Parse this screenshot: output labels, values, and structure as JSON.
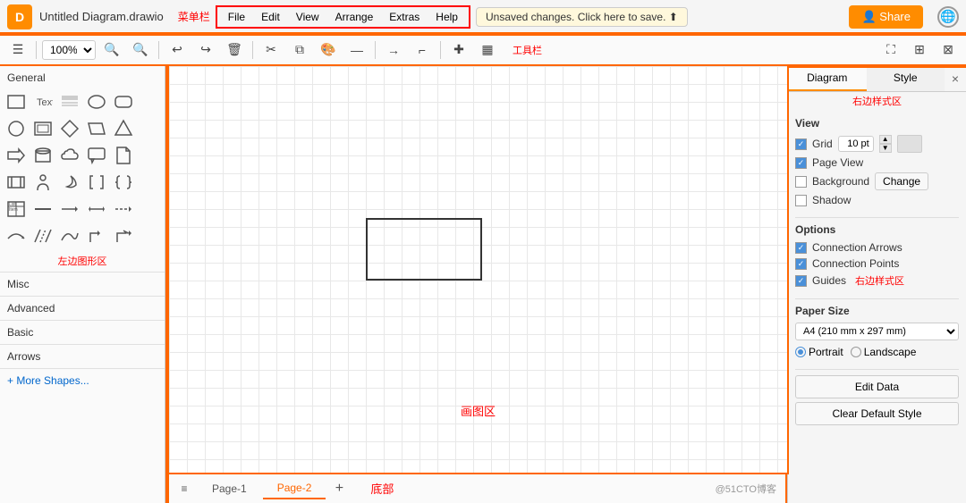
{
  "app": {
    "title": "Untitled Diagram.drawio",
    "title_label": "菜单栏",
    "logo_text": "D"
  },
  "menu": {
    "items": [
      "File",
      "Edit",
      "View",
      "Arrange",
      "Extras",
      "Help"
    ],
    "unsaved": "Unsaved changes. Click here to save. ⬆"
  },
  "share": {
    "label": "Share"
  },
  "toolbar": {
    "label": "工具栏",
    "zoom": "100%"
  },
  "left_panel": {
    "label": "左边图形区",
    "sections": [
      {
        "title": "General"
      },
      {
        "title": "Misc"
      },
      {
        "title": "Advanced"
      },
      {
        "title": "Basic"
      },
      {
        "title": "Arrows"
      }
    ],
    "more_shapes": "+ More Shapes..."
  },
  "canvas": {
    "label": "画图区"
  },
  "bottom": {
    "label": "底部",
    "menu_icon": "≡",
    "tabs": [
      {
        "label": "Page-1",
        "active": false
      },
      {
        "label": "Page-2",
        "active": true
      }
    ],
    "add_icon": "+",
    "watermark": "@51CTO博客"
  },
  "right_panel": {
    "label": "右边样式区",
    "tabs": [
      "Diagram",
      "Style"
    ],
    "close_icon": "×",
    "view_section": {
      "title": "View",
      "grid_label": "Grid",
      "grid_value": "10 pt",
      "page_view_label": "Page View",
      "background_label": "Background",
      "change_btn": "Change",
      "shadow_label": "Shadow"
    },
    "options_section": {
      "title": "Options",
      "connection_arrows": "Connection Arrows",
      "connection_points": "Connection Points",
      "guides": "Guides"
    },
    "paper_section": {
      "title": "Paper Size",
      "size_value": "A4 (210 mm x 297 mm)",
      "portrait": "Portrait",
      "landscape": "Landscape"
    },
    "actions": {
      "edit_data": "Edit Data",
      "clear_default_style": "Clear Default Style"
    }
  }
}
